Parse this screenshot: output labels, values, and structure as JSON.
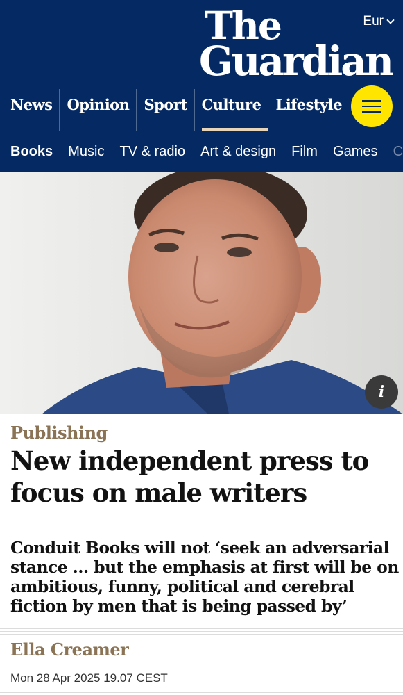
{
  "header": {
    "edition_label": "Eur",
    "logo_line1": "The",
    "logo_line2": "Guardian",
    "pillars": [
      {
        "label": "News"
      },
      {
        "label": "Opinion"
      },
      {
        "label": "Sport"
      },
      {
        "label": "Culture"
      },
      {
        "label": "Lifestyle"
      }
    ],
    "active_pillar": "Culture",
    "brand_color": "#052962",
    "menu_button_color": "#ffe500",
    "active_underline_color": "#e7d4b9"
  },
  "subnav": {
    "items": [
      {
        "label": "Books"
      },
      {
        "label": "Music"
      },
      {
        "label": "TV & radio"
      },
      {
        "label": "Art & design"
      },
      {
        "label": "Film"
      },
      {
        "label": "Games"
      },
      {
        "label": "Cla"
      }
    ],
    "active_item": "Books"
  },
  "hero": {
    "info_icon_label": "i"
  },
  "article": {
    "kicker": "Publishing",
    "headline": "New independent press to focus on male writers",
    "standfirst": "Conduit Books will not ‘seek an adversarial stance … but the emphasis at first will be on ambitious, funny, political and cerebral fiction by men that is being passed by’",
    "byline": "Ella Creamer",
    "dateline": "Mon 28 Apr 2025 19.07 CEST",
    "accent_color": "#8b7355"
  }
}
